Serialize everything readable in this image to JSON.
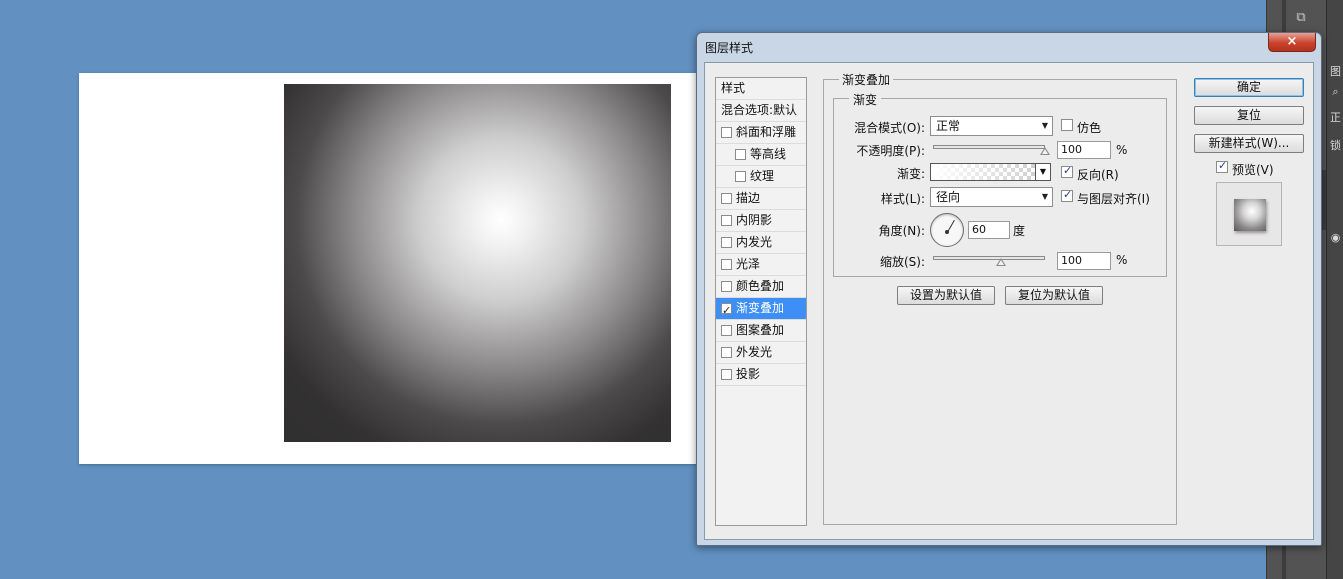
{
  "dialog": {
    "title": "图层样式",
    "close_glyph": "×"
  },
  "style_list": {
    "header": "样式",
    "blend_options": "混合选项:默认",
    "items": [
      {
        "label": "斜面和浮雕",
        "checked": false,
        "indent": false
      },
      {
        "label": "等高线",
        "checked": false,
        "indent": true
      },
      {
        "label": "纹理",
        "checked": false,
        "indent": true
      },
      {
        "label": "描边",
        "checked": false,
        "indent": false
      },
      {
        "label": "内阴影",
        "checked": false,
        "indent": false
      },
      {
        "label": "内发光",
        "checked": false,
        "indent": false
      },
      {
        "label": "光泽",
        "checked": false,
        "indent": false
      },
      {
        "label": "颜色叠加",
        "checked": false,
        "indent": false
      },
      {
        "label": "渐变叠加",
        "checked": true,
        "indent": false,
        "selected": true
      },
      {
        "label": "图案叠加",
        "checked": false,
        "indent": false
      },
      {
        "label": "外发光",
        "checked": false,
        "indent": false
      },
      {
        "label": "投影",
        "checked": false,
        "indent": false
      }
    ]
  },
  "gradient_overlay": {
    "section_title": "渐变叠加",
    "group_title": "渐变",
    "blend_mode_label": "混合模式(O):",
    "blend_mode_value": "正常",
    "dither_label": "仿色",
    "dither_checked": false,
    "opacity_label": "不透明度(P):",
    "opacity_value": "100",
    "opacity_unit": "%",
    "opacity_level": 1.0,
    "gradient_label": "渐变:",
    "reverse_label": "反向(R)",
    "reverse_checked": true,
    "style_label": "样式(L):",
    "style_value": "径向",
    "align_label": "与图层对齐(I)",
    "align_checked": true,
    "angle_label": "角度(N):",
    "angle_value": "60",
    "angle_unit": "度",
    "scale_label": "缩放(S):",
    "scale_value": "100",
    "scale_unit": "%",
    "scale_level": 0.5,
    "make_default_label": "设置为默认值",
    "reset_default_label": "复位为默认值"
  },
  "buttons": {
    "ok": "确定",
    "reset": "复位",
    "new_style": "新建样式(W)...",
    "preview_label": "预览(V)",
    "preview_checked": true
  },
  "ps_panel": {
    "dock_items": [
      "图",
      "⌕",
      "正",
      "锁",
      "◉"
    ],
    "top_icon": "⧉"
  },
  "colors": {
    "desktop": "#6190c1",
    "selection": "#3d8ff5",
    "close_button": "#c9442d"
  }
}
